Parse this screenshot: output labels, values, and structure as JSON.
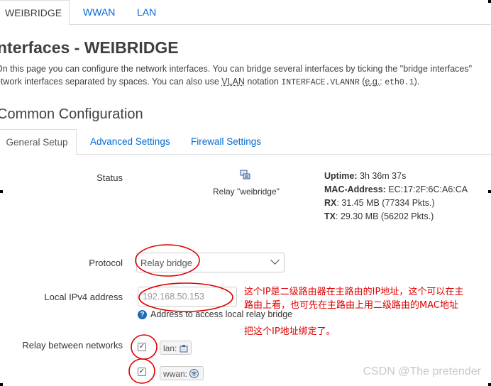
{
  "top_tabs": [
    {
      "label": "WEIBRIDGE",
      "active": true
    },
    {
      "label": "WWAN",
      "active": false
    },
    {
      "label": "LAN",
      "active": false
    }
  ],
  "page": {
    "title": "nterfaces - WEIBRIDGE",
    "desc_line1": "On this page you can configure the network interfaces. You can bridge several interfaces by ticking the \"bridge interfaces\"",
    "desc_line2_a": "etwork interfaces separated by spaces. You can also use ",
    "desc_line2_vlan": "VLAN",
    "desc_line2_b": " notation ",
    "desc_line2_code1": "INTERFACE.VLANNR",
    "desc_line2_c": " (",
    "desc_line2_eg": "e.g.",
    "desc_line2_d": ": ",
    "desc_line2_code2": "eth0.1",
    "desc_line2_e": ")."
  },
  "section": {
    "title": "Common Configuration",
    "tabs": [
      {
        "label": "General Setup",
        "active": true
      },
      {
        "label": "Advanced Settings",
        "active": false
      },
      {
        "label": "Firewall Settings",
        "active": false
      }
    ]
  },
  "status": {
    "label": "Status",
    "device": "Relay \"weibridge\"",
    "uptime_key": "Uptime:",
    "uptime_val": " 3h 36m 37s",
    "mac_key": "MAC-Address:",
    "mac_val": " EC:17:2F:6C:A6:CA",
    "rx_key": "RX",
    "rx_val": ": 31.45 MB (77334 Pkts.)",
    "tx_key": "TX",
    "tx_val": ": 29.30 MB (56202 Pkts.)"
  },
  "protocol": {
    "label": "Protocol",
    "value": "Relay bridge"
  },
  "ipv4": {
    "label": "Local IPv4 address",
    "placeholder": "192.168.50.153",
    "hint": "Address to access local relay bridge"
  },
  "relay": {
    "label": "Relay between networks",
    "networks": [
      {
        "name": "lan:",
        "checked": true
      },
      {
        "name": "wwan:",
        "checked": true
      }
    ]
  },
  "annotation": {
    "line1": "这个IP是二级路由器在主路由的IP地址，这个可以在主",
    "line2": "路由上看，也可先在主路由上用二级路由的MAC地址",
    "line3": "把这个IP地址绑定了。"
  },
  "watermark": "CSDN @The  pretender",
  "colors": {
    "link": "#0069d6",
    "annotation": "#e00000",
    "hint_icon": "#1b6bb8"
  }
}
